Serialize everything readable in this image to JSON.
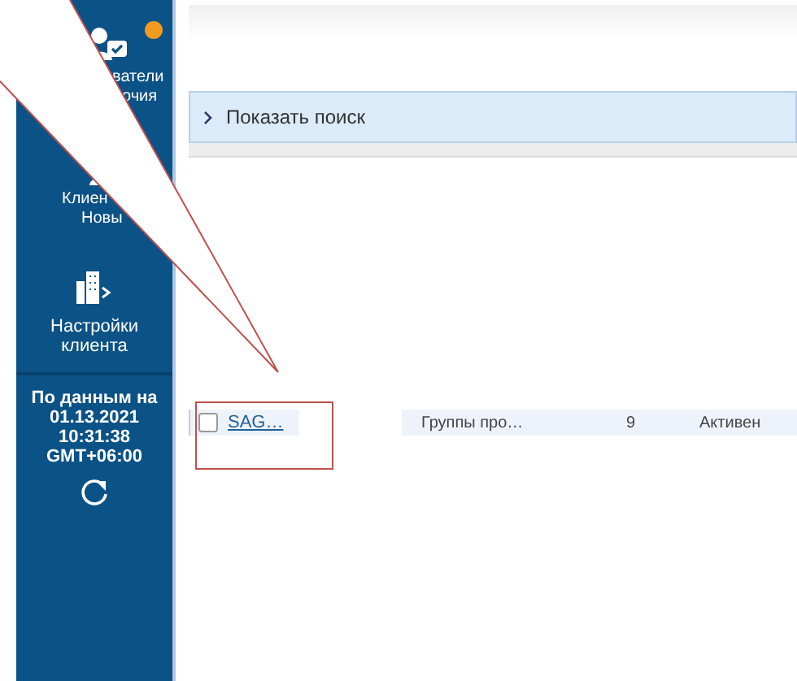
{
  "sidebar": {
    "notification": true,
    "items": [
      {
        "kind": "users",
        "lines": [
          "ватели",
          "очия"
        ]
      },
      {
        "kind": "clients",
        "lines": [
          "Клиен",
          "Новы"
        ]
      },
      {
        "kind": "settings",
        "lines": [
          "Настройки",
          "клиента"
        ]
      }
    ],
    "status": {
      "lines": [
        "По данным на",
        "01.13.2021",
        "10:31:38",
        "GMT+06:00"
      ]
    }
  },
  "search_toggle": {
    "label": "Показать поиск",
    "expanded": false
  },
  "table": {
    "rows": [
      {
        "checked": false,
        "cells": [
          "SAG…",
          "Группы про…",
          "9",
          "Активен"
        ]
      }
    ]
  }
}
